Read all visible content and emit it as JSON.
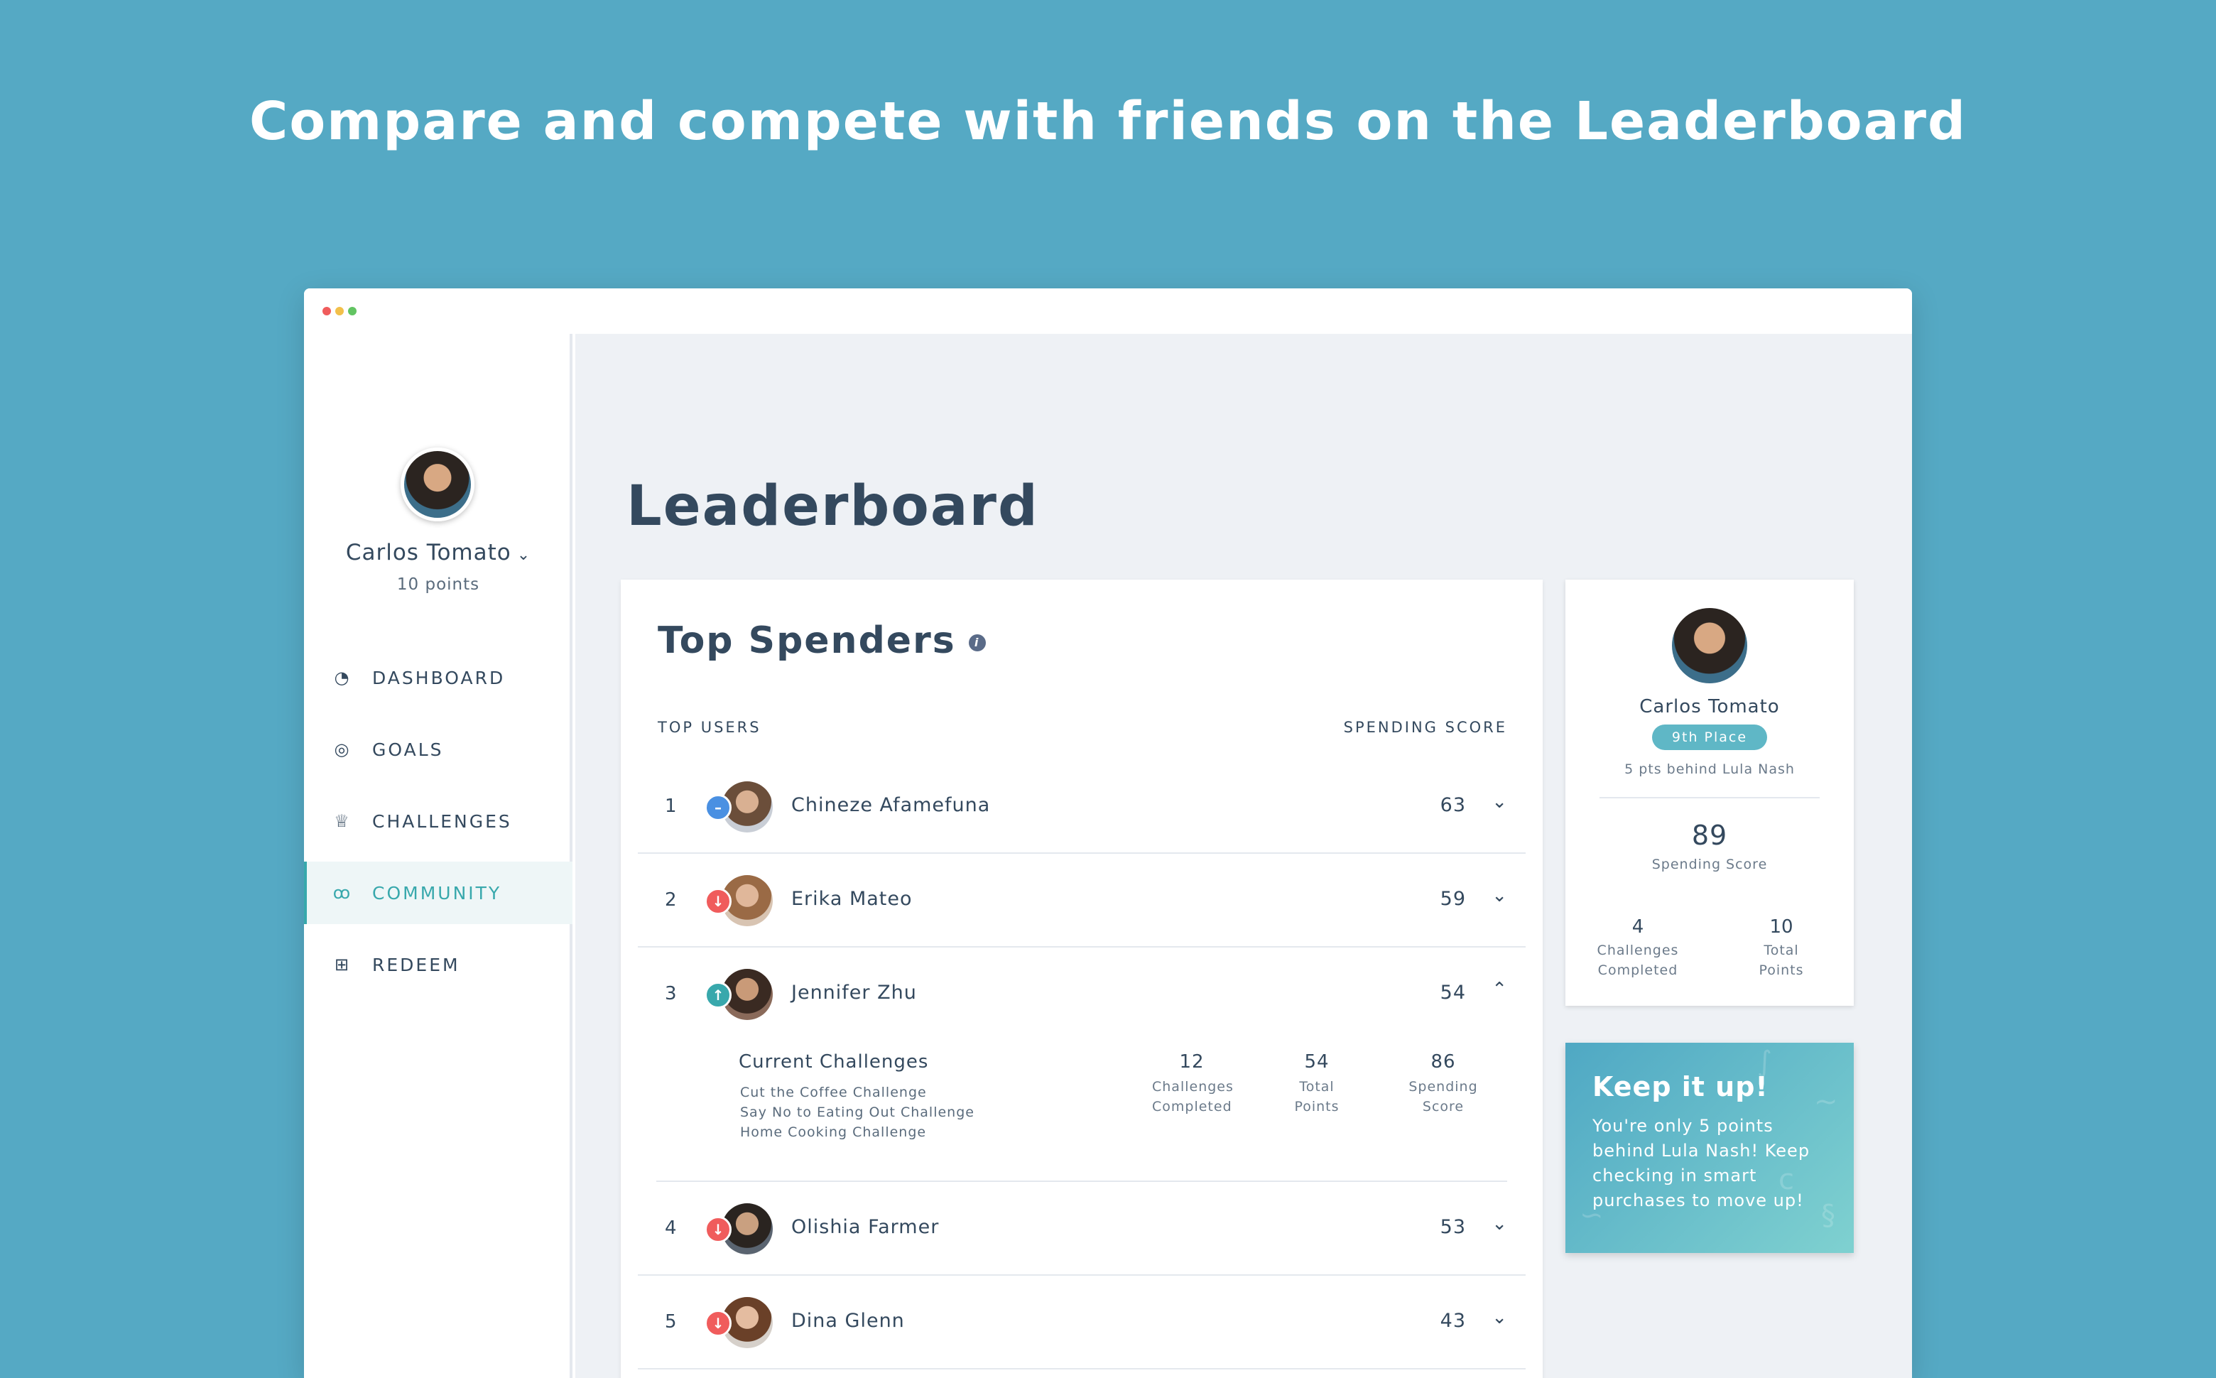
{
  "headline": "Compare and compete with friends on the Leaderboard",
  "user": {
    "name": "Carlos Tomato",
    "points": "10 points"
  },
  "nav": [
    {
      "label": "DASHBOARD",
      "icon": "gauge-icon",
      "active": false
    },
    {
      "label": "GOALS",
      "icon": "target-icon",
      "active": false
    },
    {
      "label": "CHALLENGES",
      "icon": "trophy-icon",
      "active": false
    },
    {
      "label": "COMMUNITY",
      "icon": "people-icon",
      "active": true
    },
    {
      "label": "REDEEM",
      "icon": "gift-icon",
      "active": false
    }
  ],
  "page_title": "Leaderboard",
  "leaderboard": {
    "title": "Top Spenders",
    "col_users": "TOP USERS",
    "col_score": "SPENDING SCORE",
    "rows": [
      {
        "rank": "1",
        "name": "Chineze Afamefuna",
        "score": "63",
        "trend": "same"
      },
      {
        "rank": "2",
        "name": "Erika Mateo",
        "score": "59",
        "trend": "down"
      },
      {
        "rank": "3",
        "name": "Jennifer Zhu",
        "score": "54",
        "trend": "up"
      },
      {
        "rank": "4",
        "name": "Olishia Farmer",
        "score": "53",
        "trend": "down"
      },
      {
        "rank": "5",
        "name": "Dina Glenn",
        "score": "43",
        "trend": "down"
      }
    ],
    "expanded": {
      "current_challenges_label": "Current Challenges",
      "challenges": [
        "Cut the Coffee Challenge",
        "Say No to Eating Out Challenge",
        "Home Cooking Challenge"
      ],
      "stats": [
        {
          "value": "12",
          "label": "Challenges Completed"
        },
        {
          "value": "54",
          "label": "Total Points"
        },
        {
          "value": "86",
          "label": "Spending Score"
        }
      ]
    }
  },
  "profile_card": {
    "name": "Carlos Tomato",
    "place": "9th Place",
    "behind": "5 pts behind Lula Nash",
    "spending_score": "89",
    "spending_score_label": "Spending Score",
    "stats": [
      {
        "value": "4",
        "label": "Challenges Completed"
      },
      {
        "value": "10",
        "label": "Total Points"
      }
    ]
  },
  "promo": {
    "title": "Keep it up!",
    "text": "You're only 5 points behind Lula Nash! Keep checking in smart purchases to move up!"
  },
  "colors": {
    "background": "#55a9c4",
    "accent": "#38a8ac",
    "down": "#f05c5c",
    "same": "#4a90e2"
  }
}
